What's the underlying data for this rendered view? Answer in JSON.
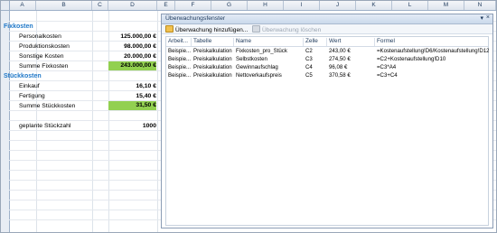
{
  "columns": [
    "A",
    "B",
    "C",
    "D",
    "E",
    "F",
    "G",
    "H",
    "I",
    "J",
    "K",
    "L",
    "M",
    "N"
  ],
  "sheet": {
    "fix_header": "Fixkosten",
    "rows_fix": [
      {
        "label": "Personalkosten",
        "value": "125.000,00 €"
      },
      {
        "label": "Produktionskosten",
        "value": "98.000,00 €"
      },
      {
        "label": "Sonstige Kosten",
        "value": "20.000,00 €"
      },
      {
        "label": "Summe Fixkosten",
        "value": "243.000,00 €"
      }
    ],
    "stk_header": "Stückkosten",
    "rows_stk": [
      {
        "label": "Einkauf",
        "value": "16,10 €"
      },
      {
        "label": "Fertigung",
        "value": "15,40 €"
      },
      {
        "label": "Summe Stückkosten",
        "value": "31,50 €"
      }
    ],
    "qty_label": "geplante Stückzahl",
    "qty_value": "1000"
  },
  "watch": {
    "title": "Überwachungsfenster",
    "add_label": "Überwachung hinzufügen...",
    "delete_label": "Überwachung löschen",
    "headers": [
      "Arbeit...",
      "Tabelle",
      "Name",
      "Zelle",
      "Wert",
      "Formel"
    ],
    "rows": [
      {
        "wb": "Beispie...",
        "sheet": "Preiskalkulation",
        "name": "Fixkosten_pro_Stück",
        "cell": "C2",
        "value": "243,00 €",
        "formula": "=Kostenaufstellung!D6/Kostenaufstellung!D12"
      },
      {
        "wb": "Beispie...",
        "sheet": "Preiskalkulation",
        "name": "Selbstkosten",
        "cell": "C3",
        "value": "274,50 €",
        "formula": "=C2+Kostenaufstellung!D10"
      },
      {
        "wb": "Beispie...",
        "sheet": "Preiskalkulation",
        "name": "Gewinnaufschlag",
        "cell": "C4",
        "value": "96,08 €",
        "formula": "=C3*A4"
      },
      {
        "wb": "Beispie...",
        "sheet": "Preiskalkulation",
        "name": "Nettoverkaufspreis",
        "cell": "C5",
        "value": "370,58 €",
        "formula": "=C3+C4"
      }
    ]
  },
  "colors": {
    "header_blue": "#1f78c8",
    "highlight_green": "#92d050"
  }
}
